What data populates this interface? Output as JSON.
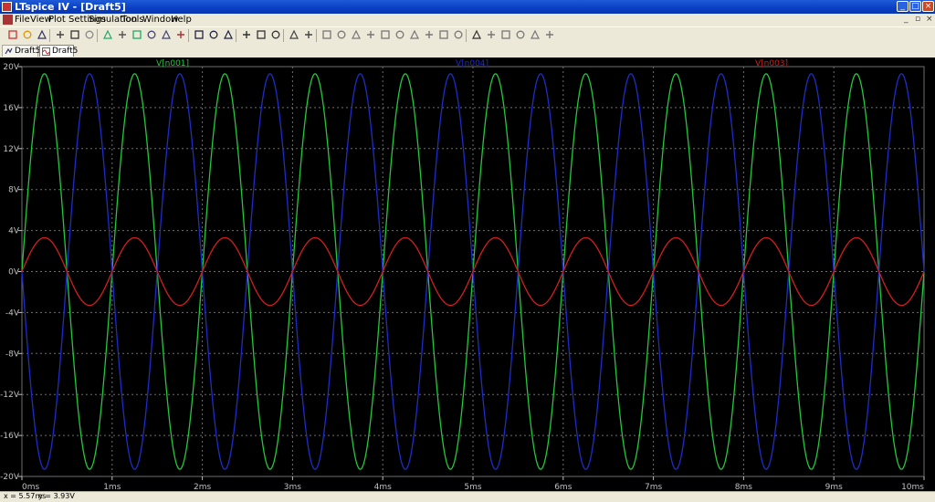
{
  "window": {
    "title": "LTspice IV - [Draft5]",
    "controls": {
      "minimize": "_",
      "maximize": "□",
      "close": "×"
    }
  },
  "menubar": {
    "items": [
      "File",
      "View",
      "Plot Settings",
      "Simulation",
      "Tools",
      "Window",
      "Help"
    ],
    "mdi_controls": {
      "minimize": "_",
      "restore": "▫",
      "close": "×"
    }
  },
  "toolbar": {
    "icons": [
      "new-schematic",
      "open",
      "save",
      "control-panel",
      "run",
      "halt",
      "zoom-in",
      "pan",
      "zoom-out",
      "zoom-fit",
      "autorange",
      "ruler",
      "tile-horizontal",
      "tile-vertical",
      "cascade",
      "cut",
      "copy",
      "find",
      "print-preview",
      "print",
      "wire",
      "ground",
      "label",
      "resistor",
      "capacitor",
      "inductor",
      "diode",
      "component",
      "move",
      "drag",
      "undo",
      "redo",
      "rotate",
      "mirror",
      "text",
      "spice-directive"
    ]
  },
  "tabs": [
    {
      "label": "Draft5",
      "kind": "schematic",
      "active": false
    },
    {
      "label": "Draft5",
      "kind": "waveform",
      "active": true
    }
  ],
  "colors": {
    "plot_background": "#000000",
    "grid": "#6e6e6e",
    "axis_text": "#c0c0c0",
    "trace_n001": "#22c83c",
    "trace_n004": "#1e2dc8",
    "trace_n003": "#d21e1e"
  },
  "chart_data": {
    "type": "line",
    "title": "",
    "xlabel": "",
    "ylabel": "",
    "xlim": [
      0,
      10
    ],
    "ylim": [
      -20,
      20
    ],
    "x_unit": "ms",
    "y_unit": "V",
    "grid": true,
    "legend": "top",
    "x_ticks": [
      "0ms",
      "1ms",
      "2ms",
      "3ms",
      "4ms",
      "5ms",
      "6ms",
      "7ms",
      "8ms",
      "9ms",
      "10ms"
    ],
    "y_ticks": [
      "20V",
      "16V",
      "12V",
      "8V",
      "4V",
      "0V",
      "-4V",
      "-8V",
      "-12V",
      "-16V",
      "-20V"
    ],
    "series": [
      {
        "name": "V[n001]",
        "color": "#22c83c",
        "waveform": "sine",
        "amplitude": 19.3,
        "frequency_khz": 1.0,
        "phase_deg": 0
      },
      {
        "name": "V[n004]",
        "color": "#1e2dc8",
        "waveform": "sine",
        "amplitude": 19.3,
        "frequency_khz": 1.0,
        "phase_deg": 180
      },
      {
        "name": "V[n003]",
        "color": "#d21e1e",
        "waveform": "sine",
        "amplitude": 3.3,
        "frequency_khz": 1.0,
        "phase_deg": 0
      }
    ]
  },
  "status": {
    "cursor_x": "x = 5.57ms",
    "cursor_y": "y = 3.93V"
  }
}
